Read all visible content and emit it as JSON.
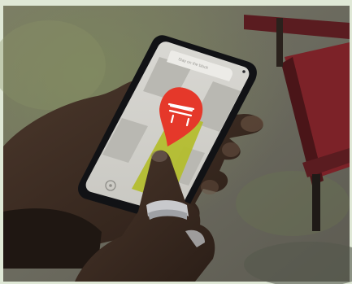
{
  "phone": {
    "search_placeholder": "Stay on the block"
  },
  "map": {
    "pin_icon": "bench-icon",
    "pin_color": "#e5382a",
    "route_color": "#b3bd2a"
  },
  "palette": {
    "frame": "#dfe8d6",
    "pavement": "#6f6c63",
    "bench_red": "#7c2228",
    "skin": "#3b2a20"
  }
}
